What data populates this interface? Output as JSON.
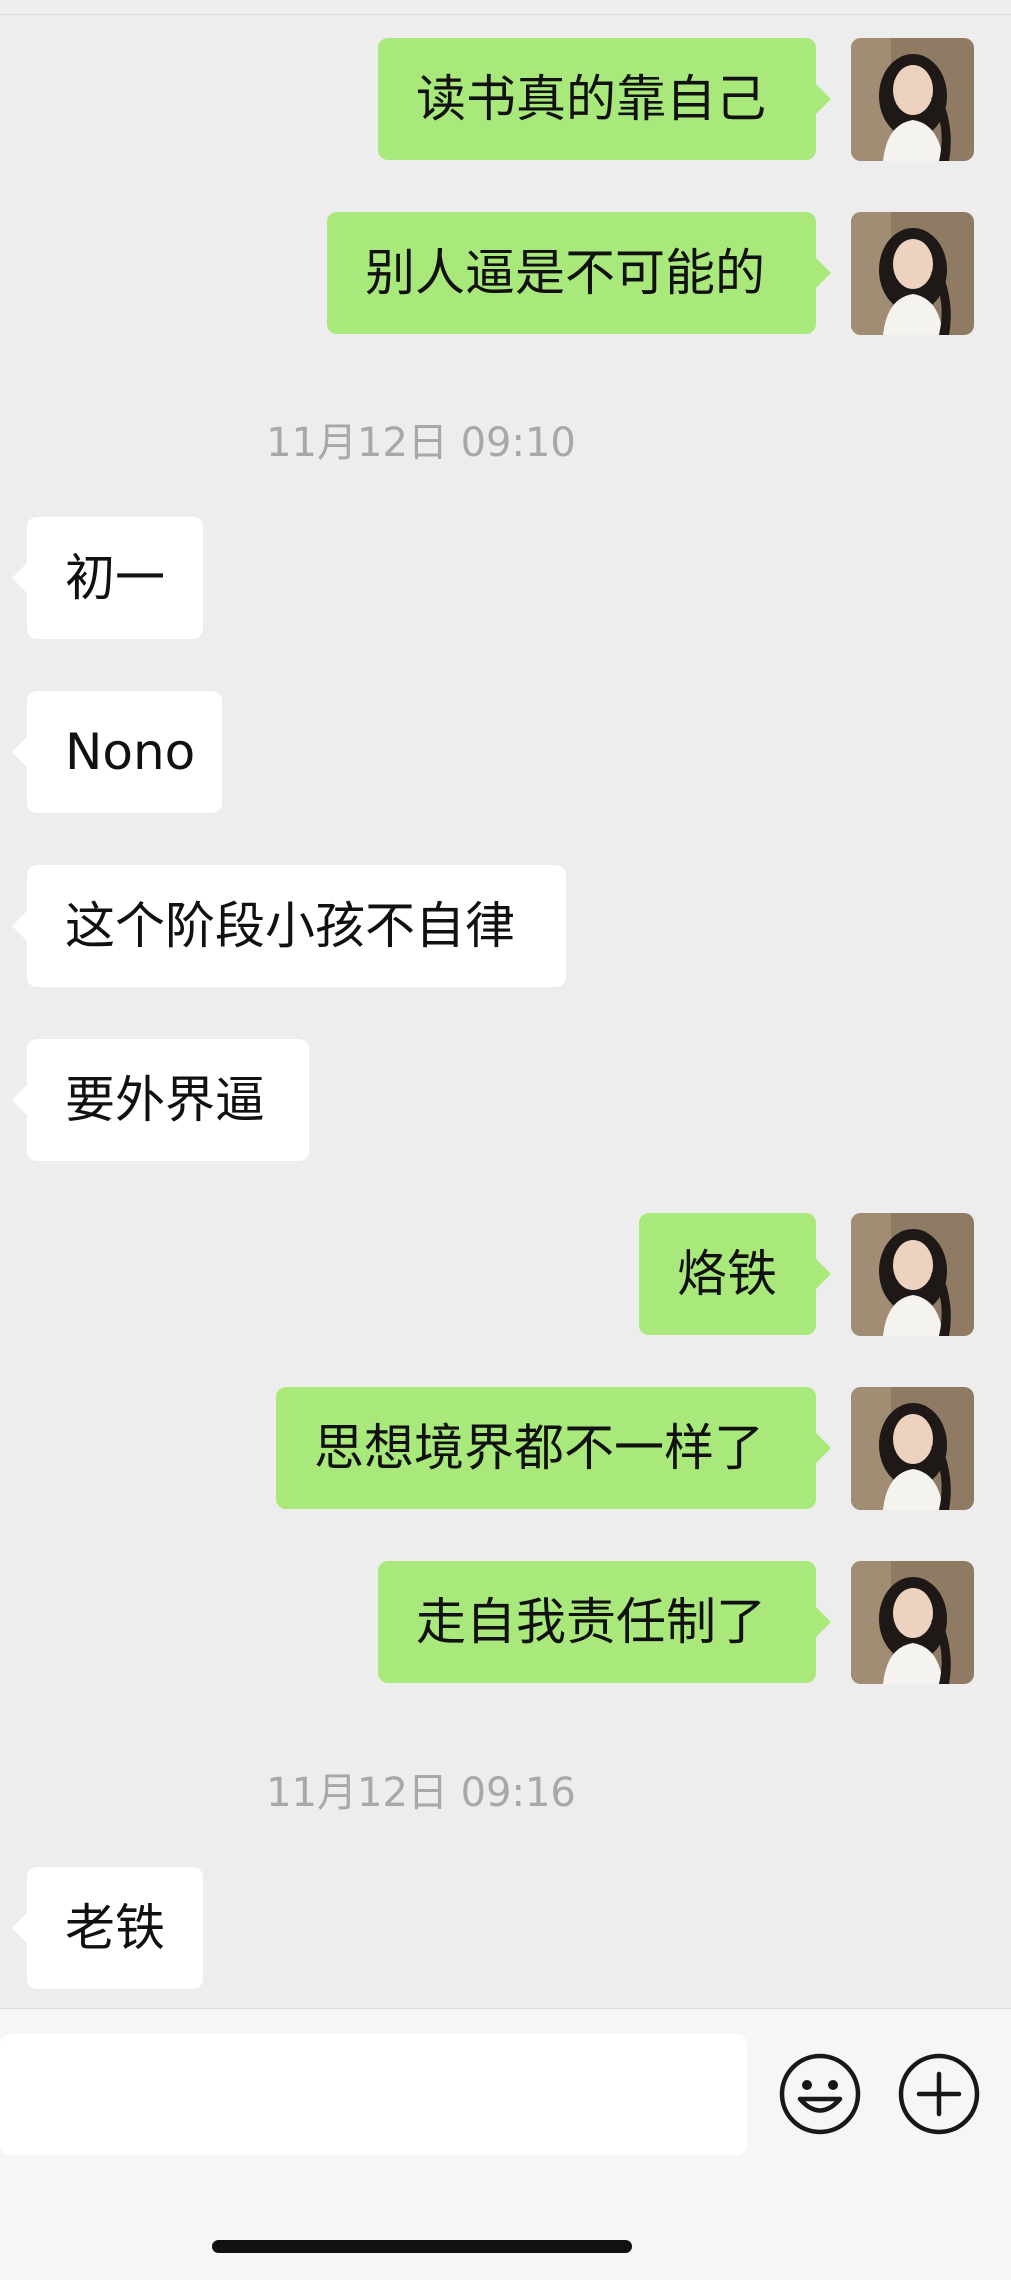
{
  "theme": {
    "background": "#ededed",
    "sent_bubble_color": "#a9e97b",
    "received_bubble_color": "#ffffff",
    "timestamp_color": "#a8a8a8"
  },
  "messages": [
    {
      "direction": "sent",
      "text": "读书真的靠自己"
    },
    {
      "direction": "sent",
      "text": "别人逼是不可能的"
    },
    {
      "type": "time",
      "text": "11月12日 09:10"
    },
    {
      "direction": "received",
      "text": "初一"
    },
    {
      "direction": "received",
      "text": "Nono"
    },
    {
      "direction": "received",
      "text": "这个阶段小孩不自律"
    },
    {
      "direction": "received",
      "text": "要外界逼"
    },
    {
      "direction": "sent",
      "text": "烙铁"
    },
    {
      "direction": "sent",
      "text": "思想境界都不一样了"
    },
    {
      "direction": "sent",
      "text": "走自我责任制了"
    },
    {
      "type": "time",
      "text": "11月12日 09:16"
    },
    {
      "direction": "received",
      "text": "老铁"
    }
  ],
  "input_bar": {
    "text": "",
    "emoji_icon": "smiley-face-icon",
    "more_icon": "plus-circle-icon"
  }
}
